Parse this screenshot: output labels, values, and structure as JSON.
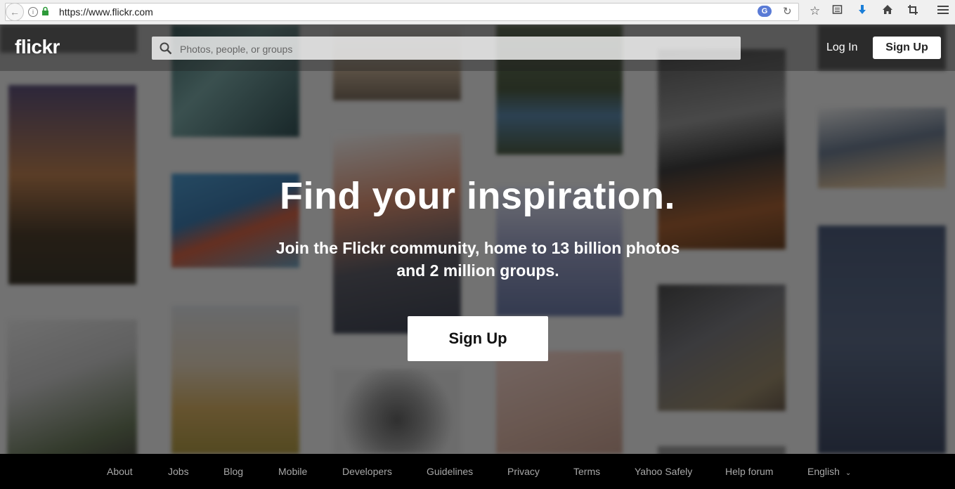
{
  "browser": {
    "url": "https://www.flickr.com",
    "colors": {
      "chrome_bg": "#f0f0f0",
      "download_arrow": "#1a7ed8"
    }
  },
  "header": {
    "logo": "flickr",
    "search_placeholder": "Photos, people, or groups",
    "login_label": "Log In",
    "signup_label": "Sign Up"
  },
  "hero": {
    "title": "Find your inspiration.",
    "subtitle": "Join the Flickr community, home to 13 billion photos and 2 million groups.",
    "signup_label": "Sign Up"
  },
  "footer": {
    "links": [
      "About",
      "Jobs",
      "Blog",
      "Mobile",
      "Developers",
      "Guidelines",
      "Privacy",
      "Terms",
      "Yahoo Safely",
      "Help forum"
    ],
    "language": "English"
  }
}
